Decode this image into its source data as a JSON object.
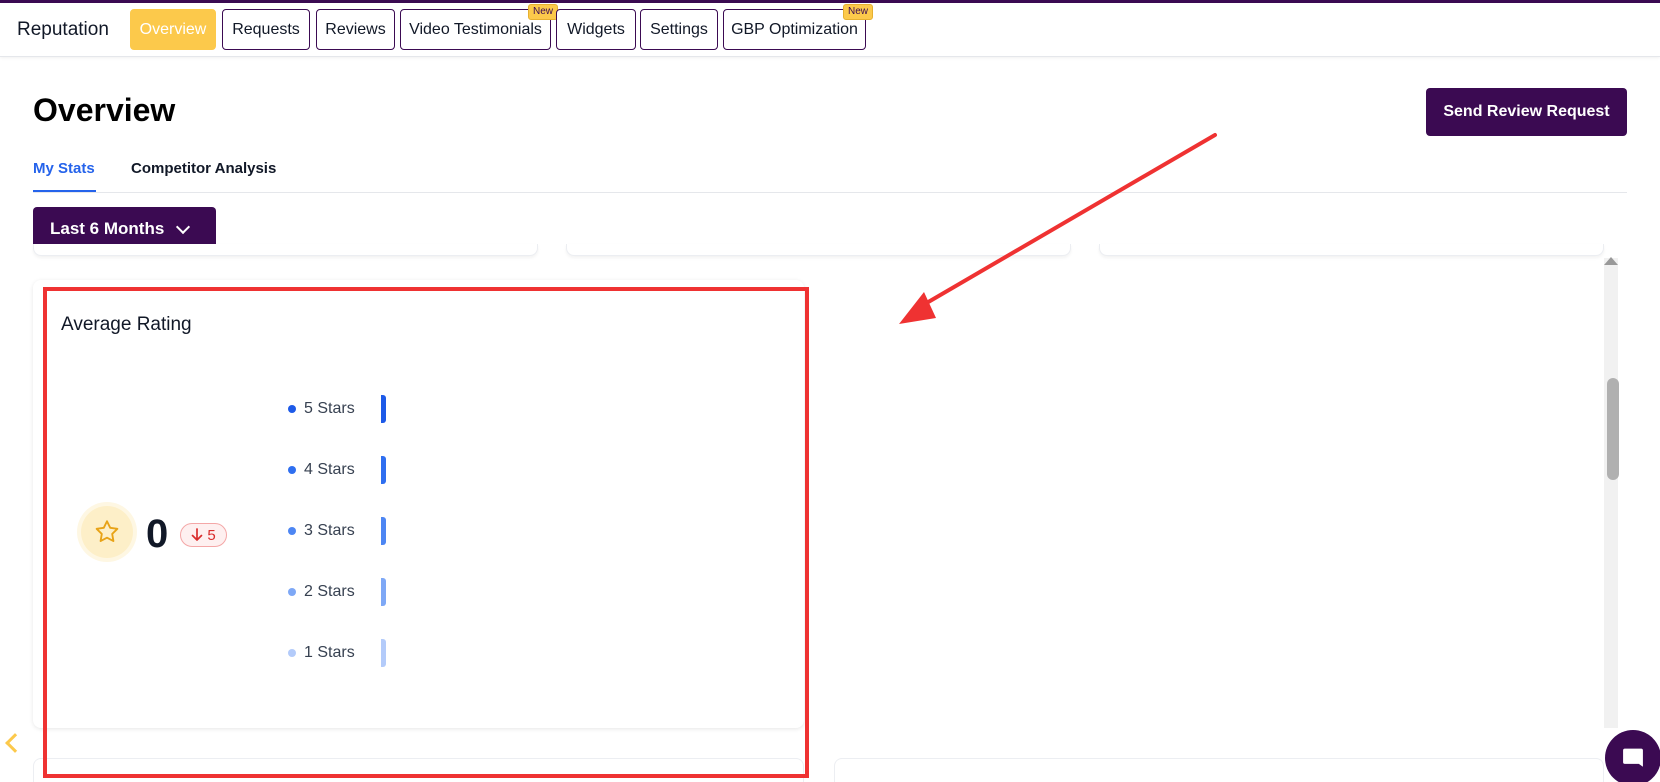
{
  "app": {
    "title": "Reputation"
  },
  "nav": {
    "tabs": [
      {
        "label": "Overview",
        "active": true
      },
      {
        "label": "Requests"
      },
      {
        "label": "Reviews"
      },
      {
        "label": "Video Testimonials",
        "badge": "New"
      },
      {
        "label": "Widgets"
      },
      {
        "label": "Settings"
      },
      {
        "label": "GBP Optimization",
        "badge": "New"
      }
    ]
  },
  "page": {
    "title": "Overview",
    "primary_action": "Send Review Request",
    "subtabs": [
      {
        "label": "My Stats",
        "active": true
      },
      {
        "label": "Competitor Analysis"
      }
    ],
    "date_range": "Last 6 Months"
  },
  "average_rating": {
    "title": "Average Rating",
    "value": "0",
    "delta": "5",
    "delta_direction": "down",
    "rows": [
      {
        "label": "5 Stars",
        "color": "#1d5ae8"
      },
      {
        "label": "4 Stars",
        "color": "#2f6ff0"
      },
      {
        "label": "3 Stars",
        "color": "#4d86f3"
      },
      {
        "label": "2 Stars",
        "color": "#7ea8f6"
      },
      {
        "label": "1 Stars",
        "color": "#b3cbfa"
      }
    ]
  },
  "colors": {
    "brand": "#3b0a52",
    "accent": "#fcc94b",
    "link": "#2563eb",
    "annotation": "#ef3232"
  },
  "icons": [
    "star-icon",
    "arrow-down-icon",
    "chevron-down-icon",
    "chevron-left-icon",
    "chat-icon"
  ]
}
